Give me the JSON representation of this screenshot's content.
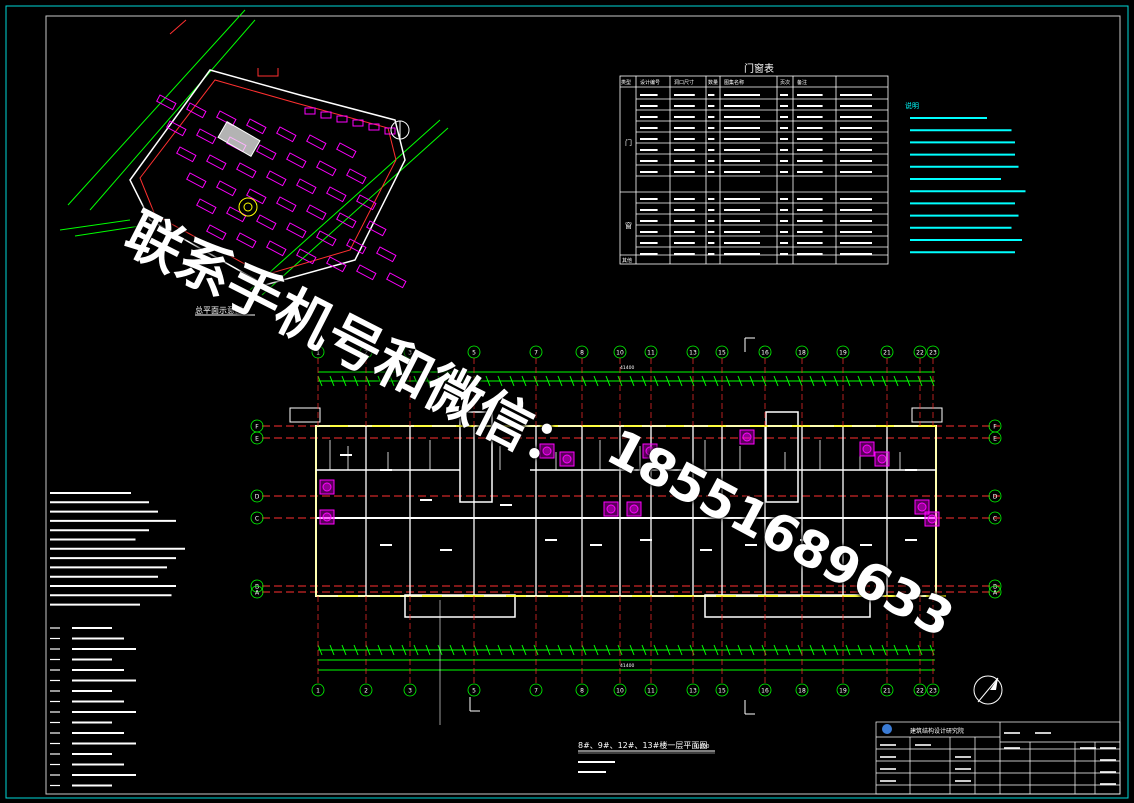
{
  "drawing": {
    "site_plan_title": "总平面示意图",
    "door_window_table_title": "门窗表",
    "door_window_table_headers": [
      "类型",
      "设计编号",
      "洞口尺寸",
      "数量",
      "图集名称",
      "页次",
      "备注"
    ],
    "door_window_table_groups": [
      "门",
      "窗"
    ],
    "door_window_table_last_group": "其他",
    "notes_title": "说明",
    "floor_plan_title": "8#、9#、12#、13#楼一层平面图",
    "floor_plan_scale": "1:100",
    "axis_labels_top": [
      "1",
      "2",
      "3",
      "5",
      "7",
      "8",
      "10",
      "11",
      "13",
      "15",
      "16",
      "18",
      "19",
      "21",
      "22",
      "23"
    ],
    "axis_labels_bottom": [
      "1",
      "2",
      "3",
      "5",
      "7",
      "8",
      "10",
      "11",
      "13",
      "15",
      "16",
      "18",
      "19",
      "21",
      "22",
      "23"
    ],
    "axis_labels_side": [
      "F",
      "E",
      "D",
      "C",
      "B",
      "A"
    ],
    "overall_dimension": "41400",
    "title_block_org": "建筑结构设计研究院",
    "colors": {
      "frame": "#00d8d8",
      "plan": "#00ff00",
      "text": "#ffffff",
      "magenta": "#ff00ff",
      "red": "#ff3030",
      "yellow": "#ffff00",
      "cyan": "#00ffff"
    }
  },
  "watermark": {
    "line1": "联系手机号和微信：",
    "line2": "18551689633"
  }
}
